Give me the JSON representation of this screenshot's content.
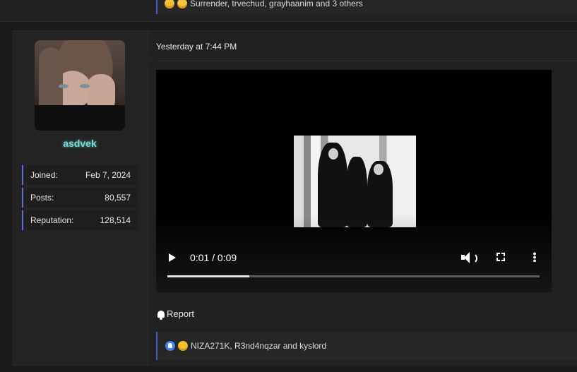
{
  "previous_post": {
    "reactions_text": "Surrender, trvechud, grayhaanim and 3 others"
  },
  "post": {
    "user": {
      "username": "asdvek",
      "stats": [
        {
          "label": "Joined:",
          "value": "Feb 7, 2024"
        },
        {
          "label": "Posts:",
          "value": "80,557"
        },
        {
          "label": "Reputation:",
          "value": "128,514"
        }
      ]
    },
    "timestamp": "Yesterday at 7:44 PM",
    "video": {
      "time_display": "0:01 / 0:09",
      "progress_fraction": 0.22
    },
    "report_label": "Report",
    "reactions_text": "NIZA271K, R3nd4nqzar and kyslord"
  },
  "colors": {
    "username": "#7fd8d4",
    "accent_border": "#4a5fc1",
    "background": "#1a1a1a"
  }
}
